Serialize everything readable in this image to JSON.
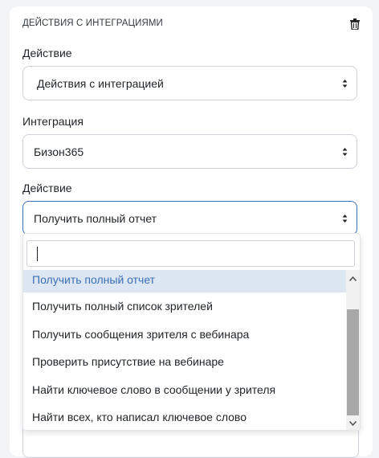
{
  "card": {
    "header": "Действия с интеграциями"
  },
  "icons": {
    "delete": "trash-icon",
    "select_arrows": "caret-up-down-icon"
  },
  "fields": {
    "action_label": "Действие",
    "action_value": "Действия с интеграцией",
    "integration_label": "Интеграция",
    "integration_value": "Бизон365",
    "sub_action_label": "Действие",
    "sub_action_value": "Получить полный отчет"
  },
  "dropdown": {
    "search_value": "",
    "options": [
      "Получить полный отчет",
      "Получить полный список зрителей",
      "Получить сообщения зрителя с вебинара",
      "Проверить присутствие на вебинаре",
      "Найти ключевое слово в сообщении у зрителя",
      "Найти всех, кто написал ключевое слово"
    ]
  },
  "colors": {
    "accent": "#3d6fb8",
    "highlight_bg": "#dde6f3",
    "highlight_text": "#3b6fb4"
  }
}
